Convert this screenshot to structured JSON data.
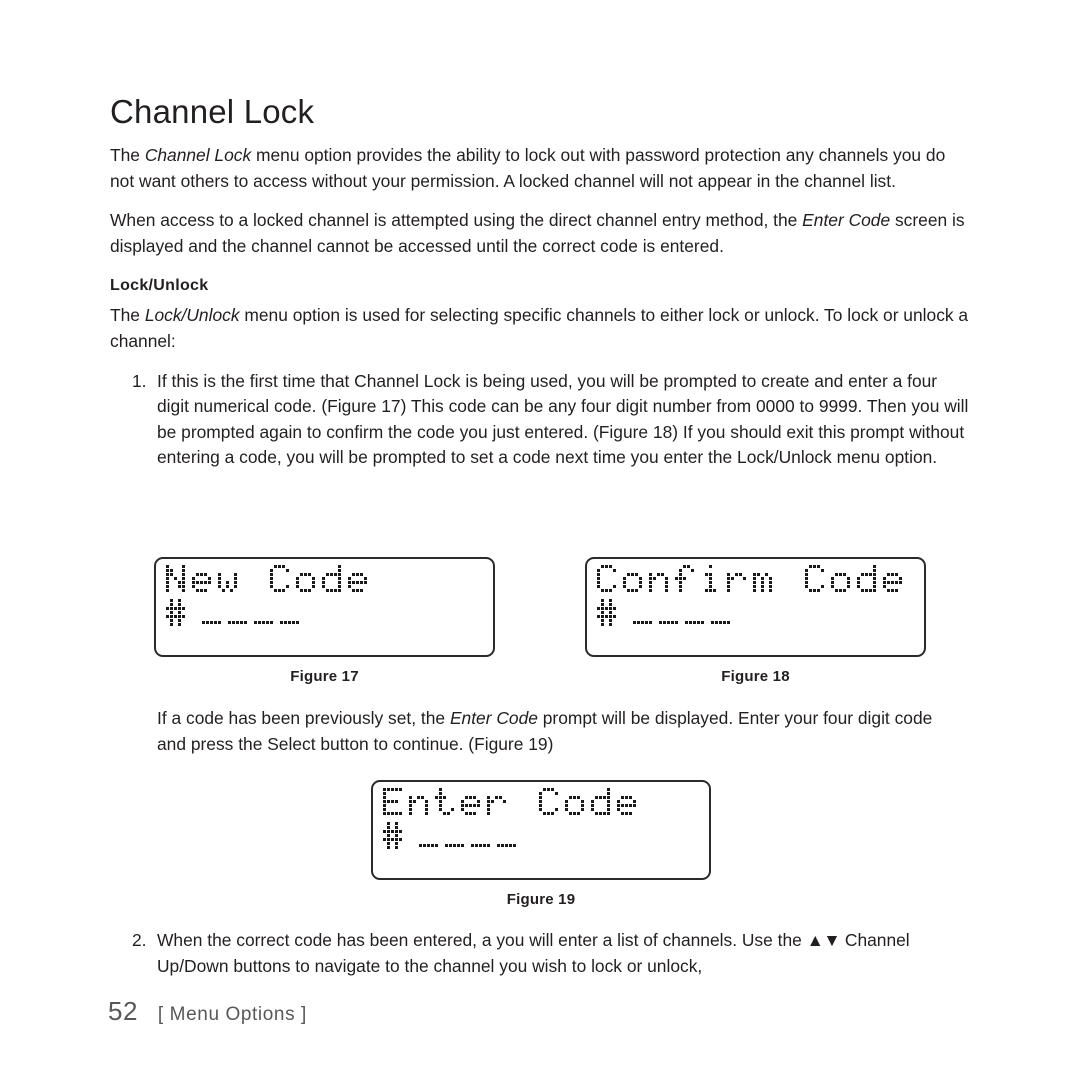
{
  "document": {
    "title": "Channel Lock",
    "page_number": "52",
    "section_label": "[ Menu Options ]"
  },
  "intro": {
    "paragraph_1": {
      "before": "The ",
      "italic": "Channel Lock",
      "after": " menu option provides the ability to lock out with password protection any channels you do not want others to access without your permission. A locked channel will not appear in the channel list."
    },
    "paragraph_2": {
      "before": "When access to a locked channel is attempted using the direct channel entry method, the ",
      "italic": "Enter Code",
      "after": " screen is displayed and the channel cannot be accessed until the correct code is entered."
    }
  },
  "lock_unlock": {
    "heading": "Lock/Unlock",
    "paragraph": {
      "before": "The ",
      "italic": "Lock/Unlock",
      "after": " menu option is used for selecting specific channels to either lock or unlock. To lock or unlock a channel:"
    },
    "steps": [
      {
        "number": "1.",
        "text": "If this is the first time that Channel Lock is being used, you will be prompted to create and enter a four digit numerical code. (Figure 17) This code can be any four digit number from 0000 to 9999. Then you will be prompted again to confirm the code you just entered. (Figure 18) If you should exit this prompt without entering a code, you will be prompted to set a code next time you enter the Lock/Unlock menu option."
      },
      {
        "number": "2.",
        "before": "When the correct code has been entered, a you will enter a list of channels. Use the ",
        "arrows": "▲▼",
        "after": " Channel Up/Down buttons to navigate to the channel you wish to lock or unlock,"
      }
    ],
    "mid_paragraph": {
      "before": "If a code has been previously set, the ",
      "italic": "Enter Code",
      "after": " prompt will be displayed. Enter your four digit code and press the Select button to continue. (Figure 19)"
    }
  },
  "figures": [
    {
      "id": "figure-17",
      "caption": "Figure 17",
      "screen_line_1": "New Code",
      "screen_prompt_symbol": "#",
      "screen_entry_placeholder": "____",
      "entry_digits": 4
    },
    {
      "id": "figure-18",
      "caption": "Figure 18",
      "screen_line_1": "Confirm Code",
      "screen_prompt_symbol": "#",
      "screen_entry_placeholder": "____",
      "entry_digits": 4
    },
    {
      "id": "figure-19",
      "caption": "Figure 19",
      "screen_line_1": "Enter Code",
      "screen_prompt_symbol": "#",
      "screen_entry_placeholder": "____",
      "entry_digits": 4
    }
  ],
  "colors": {
    "text": "#231f20",
    "footer_text": "#58585b",
    "lcd_border": "#2b2b2b",
    "lcd_dot": "#1a1a1a",
    "background": "#ffffff"
  }
}
